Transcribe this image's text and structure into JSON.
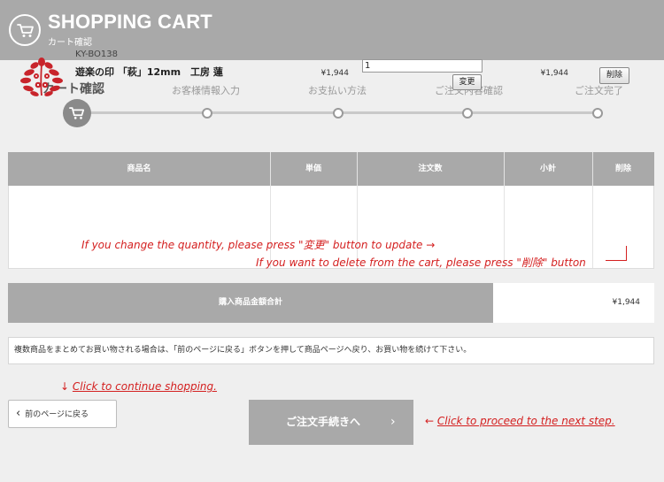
{
  "header": {
    "title": "SHOPPING CART",
    "subtitle": "カート確認"
  },
  "steps": [
    {
      "label": "カート確認",
      "active": true
    },
    {
      "label": "お客様情報入力",
      "active": false
    },
    {
      "label": "お支払い方法",
      "active": false
    },
    {
      "label": "ご注文内容確認",
      "active": false
    },
    {
      "label": "ご注文完了",
      "active": false
    }
  ],
  "table": {
    "headers": [
      "商品名",
      "単価",
      "注文数",
      "小計",
      "削除"
    ],
    "row": {
      "code": "KY-BO138",
      "name": "遊楽の印 「萩」12mm　工房 蓮",
      "unit_price": "¥1,944",
      "quantity": "1",
      "update_label": "変更",
      "subtotal": "¥1,944",
      "delete_label": "削除"
    }
  },
  "notes": {
    "quantity_note": "If you change the quantity, please press \"変更\" button to update →",
    "delete_note": "If you want to delete from the cart, please press \"削除\" button",
    "continue_arrow": "↓",
    "continue_text": "Click to continue shopping.",
    "proceed_arrow": "←",
    "proceed_text": "Click to proceed to the next step."
  },
  "total": {
    "label": "購入商品金額合計",
    "value": "¥1,944"
  },
  "info": "複数商品をまとめてお買い物される場合は、「前のページに戻る」ボタンを押して商品ページへ戻り、お買い物を続けて下さい。",
  "buttons": {
    "back": "前のページに戻る",
    "back_chevron": "‹",
    "proceed": "ご注文手続きへ",
    "proceed_chevron": "›"
  },
  "colors": {
    "header_bg": "#a9a9a9",
    "page_bg": "#efefef",
    "annotation": "#d42020"
  },
  "icons": {
    "header": "shopping-cart-icon",
    "active_step": "shopping-cart-icon",
    "product": "red-seal-stamp-image"
  }
}
